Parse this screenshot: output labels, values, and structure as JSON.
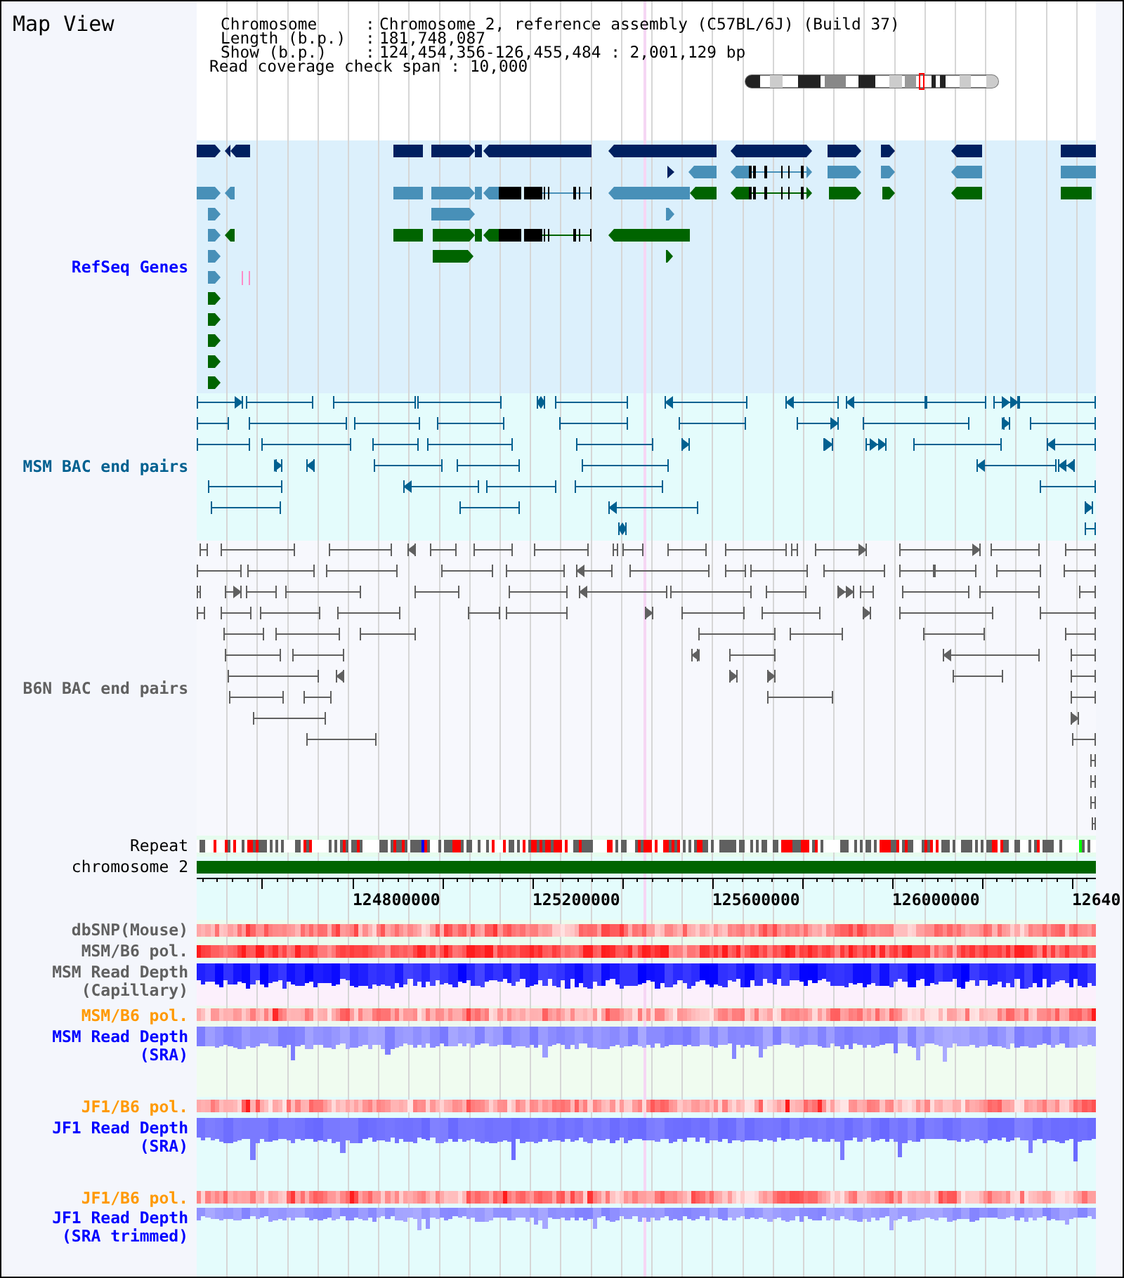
{
  "title": "Map View",
  "info": [
    {
      "label": "Chromosome",
      "separator": ":",
      "value": "Chromosome 2, reference assembly (C57BL/6J) (Build 37)"
    },
    {
      "label": "Length (b.p.)",
      "separator": ":",
      "value": "181,748,087"
    },
    {
      "label": "Show (b.p.)",
      "separator": ":",
      "value": "124,454,356-126,455,484 : 2,001,129 bp"
    }
  ],
  "coverage_span": {
    "label": "Read coverage check span",
    "separator": ":",
    "value": "10,000"
  },
  "upper_tracks": [
    {
      "label": "RefSeq Genes",
      "kind": "genes",
      "color": "#0000ff"
    },
    {
      "label": "MSM BAC end pairs",
      "kind": "pairs",
      "color": "#006090"
    },
    {
      "label": "B6N BAC end pairs",
      "kind": "pairs",
      "color": "#606060"
    },
    {
      "label": "Repeat",
      "kind": "repeats",
      "color": "#000000"
    },
    {
      "label": "chromosome 2",
      "kind": "chromosome",
      "color": "#000000"
    }
  ],
  "ruler": {
    "tick_labels": [
      "124800000",
      "125200000",
      "125600000",
      "126000000",
      "12640"
    ]
  },
  "lower_tracks": [
    {
      "label": "dbSNP(Mouse)",
      "kind": "density",
      "color": "#606060"
    },
    {
      "label": "MSM/B6 pol.",
      "kind": "density",
      "color": "#606060"
    },
    {
      "label": "MSM Read Depth (Capillary)",
      "kind": "depth",
      "color": "#606060"
    },
    {
      "label": "MSM/B6 pol.",
      "kind": "density",
      "color": "#ff9900"
    },
    {
      "label": "MSM Read Depth (SRA)",
      "kind": "depth",
      "color": "#0000ff"
    },
    {
      "label": "JF1/B6 pol.",
      "kind": "density",
      "color": "#ff9900"
    },
    {
      "label": "JF1 Read Depth (SRA)",
      "kind": "depth",
      "color": "#0000ff"
    },
    {
      "label": "JF1/B6 pol.",
      "kind": "density",
      "color": "#ff9900"
    },
    {
      "label": "JF1 Read Depth (SRA trimmed)",
      "kind": "depth",
      "color": "#0000ff"
    }
  ]
}
